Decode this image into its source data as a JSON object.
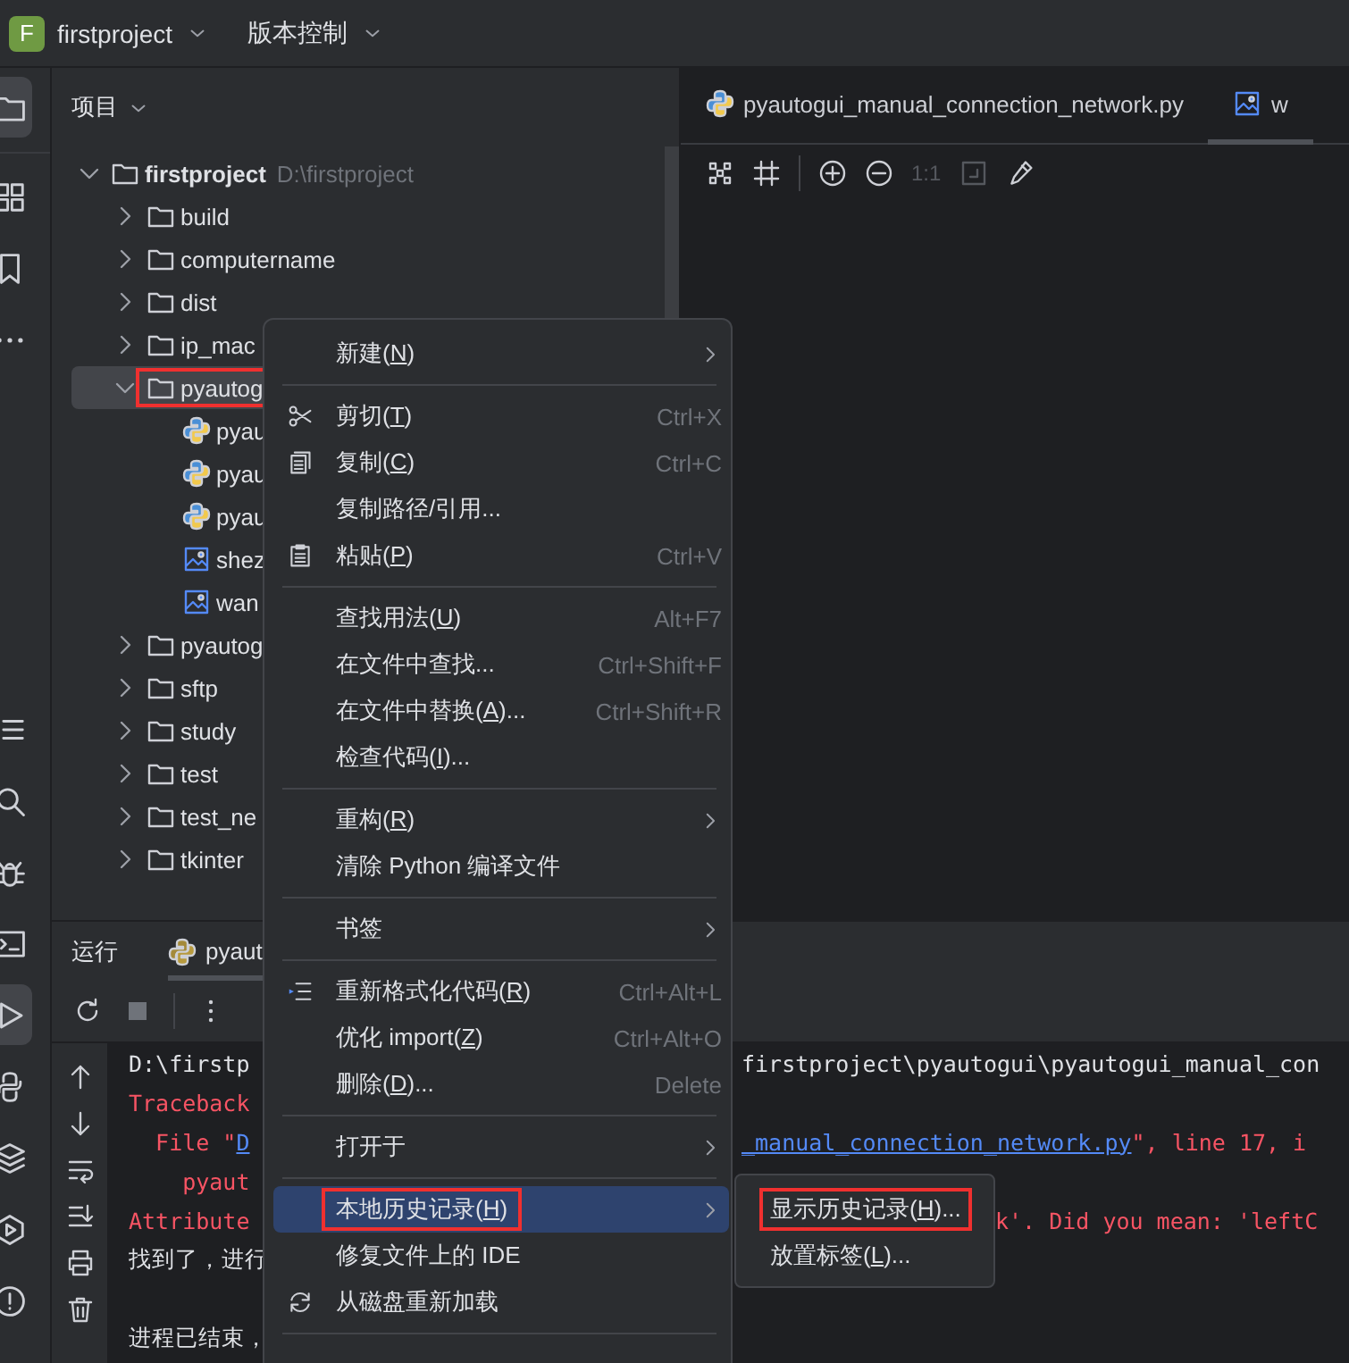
{
  "title_bar": {
    "project_badge": "F",
    "project": "firstproject",
    "vcs": "版本控制"
  },
  "tool_strip": {
    "top": [
      {
        "kind": "folder",
        "selected": true
      },
      {
        "kind": "structure",
        "selected": false
      },
      {
        "kind": "bookmark",
        "selected": false
      },
      {
        "kind": "more",
        "selected": false
      }
    ],
    "bottom": [
      {
        "kind": "list",
        "selected": false
      },
      {
        "kind": "search",
        "selected": false
      },
      {
        "kind": "bug",
        "selected": false
      },
      {
        "kind": "terminal",
        "selected": false
      },
      {
        "kind": "run",
        "selected": true
      },
      {
        "kind": "python",
        "selected": false
      },
      {
        "kind": "layers",
        "selected": false
      },
      {
        "kind": "play",
        "selected": false
      },
      {
        "kind": "warning",
        "selected": false
      }
    ]
  },
  "project_panel": {
    "title": "项目",
    "tree": [
      {
        "kind": "folder",
        "name": "firstproject",
        "path": "D:\\firstproject",
        "expanded": true,
        "selected": false,
        "annotated": false,
        "children": [
          {
            "kind": "folder",
            "name": "build",
            "expanded": false,
            "selected": false,
            "annotated": false
          },
          {
            "kind": "folder",
            "name": "computername",
            "expanded": false,
            "selected": false,
            "annotated": false
          },
          {
            "kind": "folder",
            "name": "dist",
            "expanded": false,
            "selected": false,
            "annotated": false
          },
          {
            "kind": "folder",
            "name": "ip_mac",
            "expanded": false,
            "selected": false,
            "annotated": false
          },
          {
            "kind": "folder",
            "name": "pyautog",
            "expanded": true,
            "selected": true,
            "annotated": true,
            "children": [
              {
                "kind": "python",
                "name": "pyau",
                "selected": false,
                "annotated": false
              },
              {
                "kind": "python",
                "name": "pyau",
                "selected": false,
                "annotated": false
              },
              {
                "kind": "python",
                "name": "pyau",
                "selected": false,
                "annotated": false
              },
              {
                "kind": "image",
                "name": "shez",
                "selected": false,
                "annotated": false
              },
              {
                "kind": "image",
                "name": "wan",
                "selected": false,
                "annotated": false
              }
            ]
          },
          {
            "kind": "folder",
            "name": "pyautog",
            "expanded": false,
            "selected": false,
            "annotated": false
          },
          {
            "kind": "folder",
            "name": "sftp",
            "expanded": false,
            "selected": false,
            "annotated": false
          },
          {
            "kind": "folder",
            "name": "study",
            "expanded": false,
            "selected": false,
            "annotated": false
          },
          {
            "kind": "folder",
            "name": "test",
            "expanded": false,
            "selected": false,
            "annotated": false
          },
          {
            "kind": "folder",
            "name": "test_ne",
            "expanded": false,
            "selected": false,
            "annotated": false
          },
          {
            "kind": "folder",
            "name": "tkinter",
            "expanded": false,
            "selected": false,
            "annotated": false
          }
        ]
      }
    ]
  },
  "editor": {
    "tabs": [
      {
        "kind": "python",
        "label": "pyautogui_manual_connection_network.py",
        "selected": false
      },
      {
        "kind": "image",
        "label": "w",
        "selected": true
      }
    ],
    "toolbar": [
      {
        "kind": "grid",
        "disabled": false
      },
      {
        "kind": "crop",
        "disabled": false
      },
      {
        "kind": "separator"
      },
      {
        "kind": "zoom-in",
        "disabled": false
      },
      {
        "kind": "zoom-out",
        "disabled": false
      },
      {
        "kind": "text",
        "label": "1:1",
        "disabled": true
      },
      {
        "kind": "actual-size",
        "disabled": true
      },
      {
        "kind": "picker",
        "disabled": false
      }
    ]
  },
  "run_panel": {
    "title": "运行",
    "tabs": [
      {
        "kind": "python",
        "label": "pyaut",
        "selected": true
      }
    ],
    "toolbar": [
      {
        "kind": "rerun"
      },
      {
        "kind": "stop"
      },
      {
        "kind": "separator"
      },
      {
        "kind": "more"
      }
    ],
    "gutter": [
      {
        "kind": "up"
      },
      {
        "kind": "down"
      },
      {
        "kind": "wrap"
      },
      {
        "kind": "scroll-end"
      },
      {
        "kind": "print"
      },
      {
        "kind": "trash"
      }
    ],
    "console": [
      {
        "left": [
          {
            "kind": "plain",
            "text": "D:\\firstp"
          }
        ],
        "right": [
          {
            "kind": "plain",
            "text": "firstproject\\pyautogui\\pyautogui_manual_con"
          }
        ]
      },
      {
        "left": [
          {
            "kind": "error",
            "text": "Traceback"
          }
        ]
      },
      {
        "left": [
          {
            "kind": "error",
            "text": "  File \""
          },
          {
            "kind": "link",
            "text": "D"
          }
        ],
        "right": [
          {
            "kind": "link",
            "text": "_manual_connection_network.py"
          },
          {
            "kind": "error",
            "text": "\", line 17, i"
          }
        ]
      },
      {
        "left": [
          {
            "kind": "error",
            "text": "    pyaut"
          }
        ]
      },
      {
        "left": [
          {
            "kind": "error",
            "text": "Attribute"
          }
        ],
        "far_right": [
          {
            "kind": "error",
            "text": "k'. Did you mean: 'leftC"
          }
        ]
      },
      {
        "left": [
          {
            "kind": "plain",
            "text": "找到了，进行"
          }
        ]
      },
      {
        "left": [
          {
            "kind": "plain",
            "text": "进程已结束，"
          }
        ],
        "separated": true
      }
    ]
  },
  "context_menu": {
    "items": [
      {
        "kind": "item",
        "text": "新建(",
        "mnemonic": "N",
        "after": ")",
        "has_submenu": true,
        "selected": false,
        "annotated": false
      },
      {
        "kind": "separator"
      },
      {
        "kind": "cut",
        "text": "剪切(",
        "mnemonic": "T",
        "after": ")",
        "shortcut": "Ctrl+X",
        "has_submenu": false,
        "selected": false,
        "annotated": false
      },
      {
        "kind": "copy",
        "text": "复制(",
        "mnemonic": "C",
        "after": ")",
        "shortcut": "Ctrl+C",
        "has_submenu": false,
        "selected": false,
        "annotated": false
      },
      {
        "kind": "item",
        "text": "复制路径/引用...",
        "has_submenu": false,
        "selected": false,
        "annotated": false
      },
      {
        "kind": "paste",
        "text": "粘贴(",
        "mnemonic": "P",
        "after": ")",
        "shortcut": "Ctrl+V",
        "has_submenu": false,
        "selected": false,
        "annotated": false
      },
      {
        "kind": "separator"
      },
      {
        "kind": "item",
        "text": "查找用法(",
        "mnemonic": "U",
        "after": ")",
        "shortcut": "Alt+F7",
        "has_submenu": false,
        "selected": false,
        "annotated": false
      },
      {
        "kind": "item",
        "text": "在文件中查找...",
        "shortcut": "Ctrl+Shift+F",
        "has_submenu": false,
        "selected": false,
        "annotated": false
      },
      {
        "kind": "item",
        "text": "在文件中替换(",
        "mnemonic": "A",
        "after": ")...",
        "shortcut": "Ctrl+Shift+R",
        "has_submenu": false,
        "selected": false,
        "annotated": false
      },
      {
        "kind": "item",
        "text": "检查代码(",
        "mnemonic": "I",
        "after": ")...",
        "has_submenu": false,
        "selected": false,
        "annotated": false
      },
      {
        "kind": "separator"
      },
      {
        "kind": "item",
        "text": "重构(",
        "mnemonic": "R",
        "after": ")",
        "has_submenu": true,
        "selected": false,
        "annotated": false
      },
      {
        "kind": "item",
        "text": "清除 Python 编译文件",
        "has_submenu": false,
        "selected": false,
        "annotated": false
      },
      {
        "kind": "separator"
      },
      {
        "kind": "item",
        "text": "书签",
        "has_submenu": true,
        "selected": false,
        "annotated": false
      },
      {
        "kind": "separator"
      },
      {
        "kind": "format",
        "text": "重新格式化代码(",
        "mnemonic": "R",
        "after": ")",
        "shortcut": "Ctrl+Alt+L",
        "has_submenu": false,
        "selected": false,
        "annotated": false
      },
      {
        "kind": "item",
        "text": "优化 import(",
        "mnemonic": "Z",
        "after": ")",
        "shortcut": "Ctrl+Alt+O",
        "has_submenu": false,
        "selected": false,
        "annotated": false
      },
      {
        "kind": "item",
        "text": "删除(",
        "mnemonic": "D",
        "after": ")...",
        "shortcut": "Delete",
        "has_submenu": false,
        "selected": false,
        "annotated": false
      },
      {
        "kind": "separator"
      },
      {
        "kind": "item",
        "text": "打开于",
        "has_submenu": true,
        "selected": false,
        "annotated": false
      },
      {
        "kind": "separator"
      },
      {
        "kind": "item",
        "text": "本地历史记录(",
        "mnemonic": "H",
        "after": ")",
        "has_submenu": true,
        "selected": true,
        "annotated": true
      },
      {
        "kind": "item",
        "text": "修复文件上的 IDE",
        "has_submenu": false,
        "selected": false,
        "annotated": false
      },
      {
        "kind": "reload",
        "text": "从磁盘重新加载",
        "has_submenu": false,
        "selected": false,
        "annotated": false
      },
      {
        "kind": "separator"
      }
    ]
  },
  "submenu": {
    "items": [
      {
        "text": "显示历史记录(",
        "mnemonic": "H",
        "after": ")...",
        "selected": false,
        "annotated": true
      },
      {
        "text": "放置标签(",
        "mnemonic": "L",
        "after": ")...",
        "selected": false,
        "annotated": false
      }
    ]
  }
}
